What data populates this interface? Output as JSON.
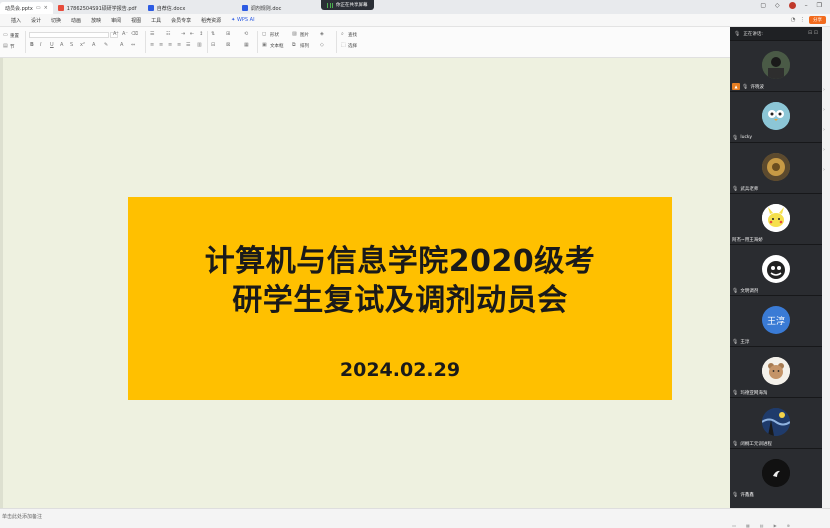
{
  "tabs": [
    {
      "label": "动员会.pptx",
      "color": "#ffffff",
      "active": true
    },
    {
      "label": "17862504S91硕研学报告.pdf",
      "color": "#e74c3c",
      "active": false
    },
    {
      "label": "自荐信.docx",
      "color": "#2d5be3",
      "active": false
    },
    {
      "label": "调剂规则.doc",
      "color": "#2d5be3",
      "active": false
    }
  ],
  "share_status": "你正在共享屏幕",
  "menu": [
    "插入",
    "设计",
    "切换",
    "动画",
    "放映",
    "审阅",
    "视图",
    "工具",
    "会员专享",
    "稻壳资源",
    "WPS AI"
  ],
  "share_button": "分享",
  "toolbar": {
    "reset": "重置",
    "section": "节",
    "shape": "形状",
    "picture": "图片",
    "textbox": "文本框",
    "arrange": "排列",
    "find": "查找",
    "select": "选择"
  },
  "slide": {
    "title_line1": "计算机与信息学院2020级考",
    "title_line2": "研学生复试及调剂动员会",
    "date": "2024.02.29"
  },
  "panel": {
    "header": "正在讲话:",
    "participants": [
      {
        "name": "许晓波",
        "avatar": "photo-dark",
        "color": "#3d4a3a",
        "initial": ""
      },
      {
        "name": "lucky",
        "avatar": "owl",
        "color": "#7ab8c8",
        "initial": ""
      },
      {
        "name": "武兵老师",
        "avatar": "photo-gold",
        "color": "#8a6d3b",
        "initial": ""
      },
      {
        "name": "阿杰~用王海娇",
        "avatar": "pikachu",
        "color": "#f5e04d",
        "initial": ""
      },
      {
        "name": "文明调剂",
        "avatar": "cartoon",
        "color": "#222222",
        "initial": ""
      },
      {
        "name": "王淳",
        "avatar": "initials",
        "color": "#3a7bd5",
        "initial": "王淳"
      },
      {
        "name": "玛德亚网海淘",
        "avatar": "bear",
        "color": "#f4f1ea",
        "initial": ""
      },
      {
        "name": "闭桐工元训进程",
        "avatar": "starry",
        "color": "#23406e",
        "initial": ""
      },
      {
        "name": "许鑫鑫",
        "avatar": "moon",
        "color": "#111111",
        "initial": ""
      }
    ]
  },
  "status": {
    "hint": "单击此处添加备注"
  }
}
